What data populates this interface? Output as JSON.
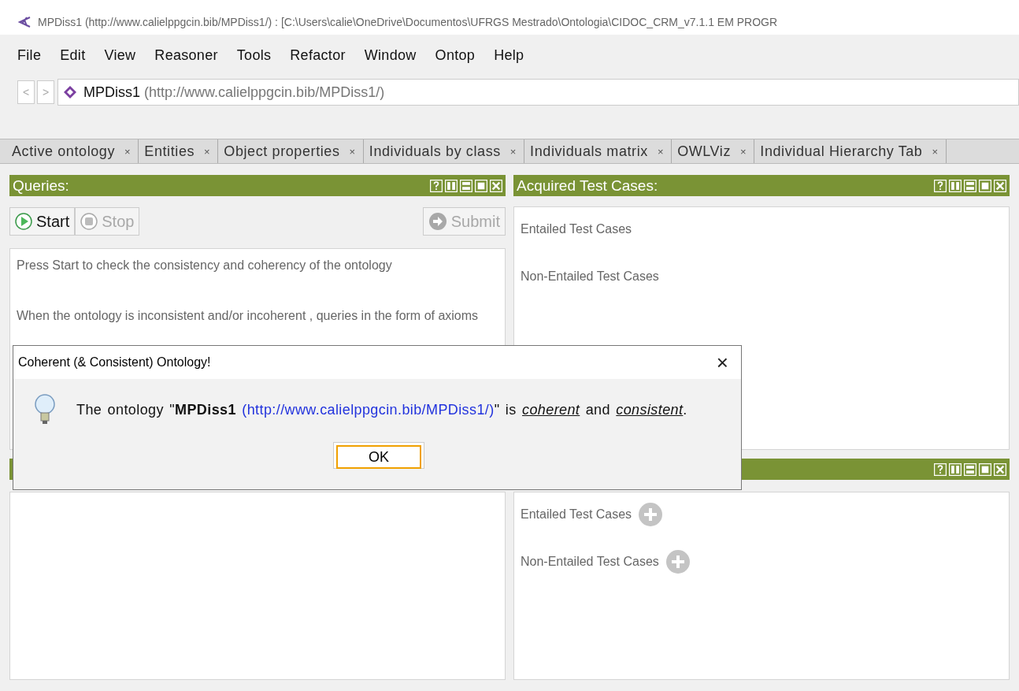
{
  "window": {
    "title": "MPDiss1 (http://www.calielppgcin.bib/MPDiss1/)  : [C:\\Users\\calie\\OneDrive\\Documentos\\UFRGS Mestrado\\Ontologia\\CIDOC_CRM_v7.1.1 EM PROGR"
  },
  "menu": [
    "File",
    "Edit",
    "View",
    "Reasoner",
    "Tools",
    "Refactor",
    "Window",
    "Ontop",
    "Help"
  ],
  "navigation": {
    "back": "<",
    "forward": ">",
    "ontology_name": "MPDiss1",
    "ontology_iri": "(http://www.calielppgcin.bib/MPDiss1/)"
  },
  "tabs": [
    {
      "label": "Active ontology",
      "close": "×"
    },
    {
      "label": "Entities",
      "close": "×"
    },
    {
      "label": "Object properties",
      "close": "×"
    },
    {
      "label": "Individuals by class",
      "close": "×"
    },
    {
      "label": "Individuals matrix",
      "close": "×"
    },
    {
      "label": "OWLViz",
      "close": "×"
    },
    {
      "label": "Individual Hierarchy Tab",
      "close": "×"
    }
  ],
  "queries_panel": {
    "title": "Queries:",
    "buttons": [
      {
        "kind": "start",
        "label": "Start",
        "disabled": false
      },
      {
        "kind": "stop",
        "label": "Stop",
        "disabled": true
      },
      {
        "kind": "submit",
        "label": "Submit",
        "disabled": true
      }
    ],
    "messages": [
      "Press Start to check the consistency and coherency of the ontology",
      "When the ontology is inconsistent and/or incoherent , queries in the form of axioms"
    ]
  },
  "acquired_panel": {
    "title": "Acquired Test Cases:",
    "sections": [
      {
        "label": "Entailed Test Cases",
        "add_button": false
      },
      {
        "label": "Non-Entailed Test Cases",
        "add_button": false
      }
    ]
  },
  "lower_panel": {
    "sections": [
      {
        "label": "Entailed Test Cases",
        "add_button": true
      },
      {
        "label": "Non-Entailed Test Cases",
        "add_button": true
      }
    ]
  },
  "dialog": {
    "title": "Coherent (& Consistent) Ontology!",
    "close": "×",
    "message": [
      {
        "kind": "plain",
        "text": "The ontology \""
      },
      {
        "kind": "bold",
        "text": "MPDiss1"
      },
      {
        "kind": "link",
        "text": " (http://www.calielppgcin.bib/MPDiss1/)"
      },
      {
        "kind": "plain",
        "text": "\" is "
      },
      {
        "kind": "emphasis",
        "text": "coherent"
      },
      {
        "kind": "plain",
        "text": " and "
      },
      {
        "kind": "emphasis",
        "text": "consistent"
      },
      {
        "kind": "plain",
        "text": "."
      }
    ],
    "ok": "OK"
  }
}
